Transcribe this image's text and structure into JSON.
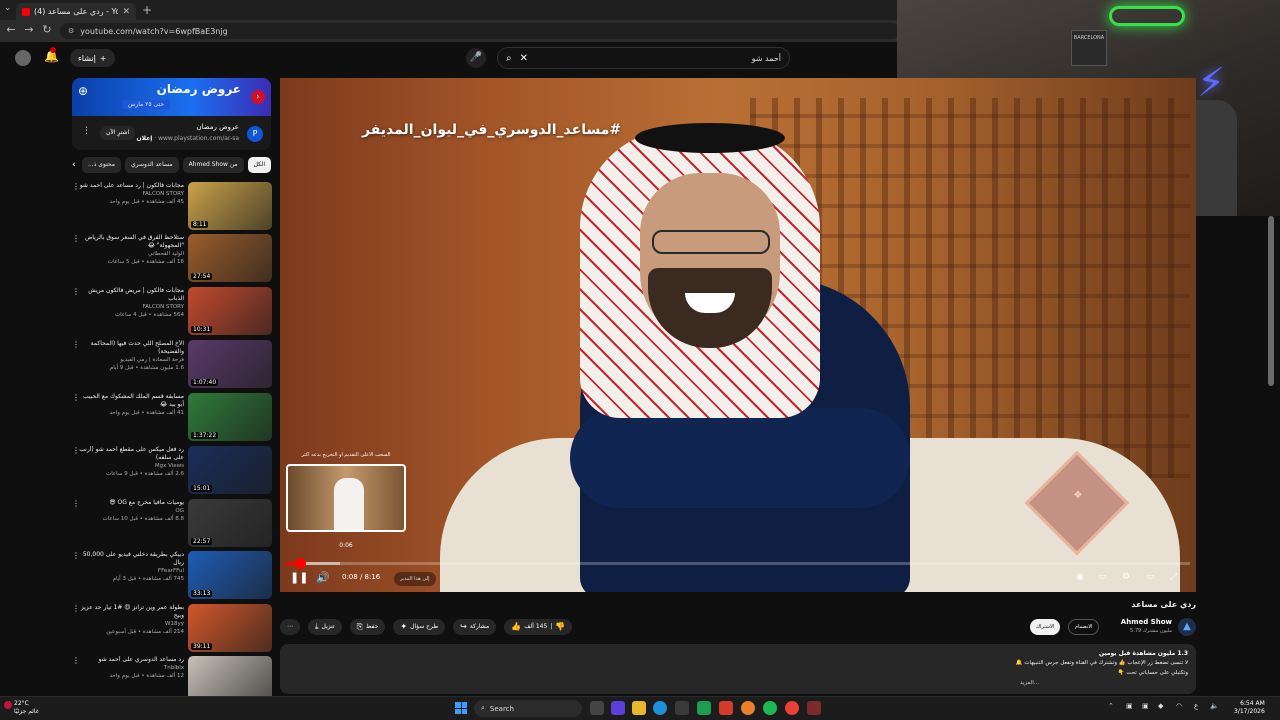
{
  "browser": {
    "tab_title": "(4) ردي على مساعد - YouTube",
    "url": "youtube.com/watch?v=6wpfBaE3njg"
  },
  "header": {
    "create_label": "إنشاء",
    "search_query": "أحمد شو"
  },
  "webcam": {
    "neon_sign": "",
    "frame_text": "BARCELONA"
  },
  "ad": {
    "banner_title": "عروض رمضان",
    "banner_sub": "حتى ٢٥ مارس",
    "title": "عروض رمضان",
    "sponsor": "إعلان",
    "domain": "www.playstation.com/ar-sa",
    "cta": "اشترِ الآن"
  },
  "chips": [
    "الكل",
    "من Ahmed Show",
    "مساعد الدوسري",
    "محتوى ذ..."
  ],
  "recommendations": [
    {
      "title": "مجابات فالكون | رد مساعد على أحمد شو",
      "channel": "FALCON STORY",
      "views": "45 ألف مشاهدة • قبل يوم واحد",
      "duration": "8:11",
      "thumb": "#c9a24a"
    },
    {
      "title": "ستلاحظ الفرق في السعر سوق بالرياض \"المجهولة\" 😂",
      "channel": "الوليد القحطاني",
      "views": "16 ألف مشاهدة • قبل 5 ساعات",
      "duration": "27:54",
      "thumb": "#9a5d2c"
    },
    {
      "title": "مجابات فالكون | مريض فالكون مريش الذباب",
      "channel": "FALCON STORY",
      "views": "564 مشاهدة • قبل 4 ساعات",
      "duration": "10:31",
      "thumb": "#c24a2f"
    },
    {
      "title": "الأخ المصلح اللي حدث فيها (المحاكمة والفضيحة)",
      "channel": "فرحة السعادة | رمي الفيديو",
      "views": "1.6 مليون مشاهدة • قبل 9 أيام",
      "duration": "1:07:40",
      "thumb": "#5a3a6a"
    },
    {
      "title": "مسابقة قسم الملك المشكوك مع الحبيب أبو بيد 😂",
      "channel": "",
      "views": "41 ألف مشاهدة • قبل يوم واحد",
      "duration": "1:37:22",
      "thumb": "#2f7a3a"
    },
    {
      "title": "رد فعل ميكس على مقطع أحمد شو (أرنب على سلفه)",
      "channel": "Mgx Views",
      "views": "2.6 ألف مشاهدة • قبل 9 ساعات",
      "duration": "15:01",
      "thumb": "#1a2e5a"
    },
    {
      "title": "يوميات مافيا مخرج مع OG 😎",
      "channel": "OG",
      "views": "8.8 ألف مشاهدة • قبل 10 ساعات",
      "duration": "22:57",
      "thumb": "#3a3a3a"
    },
    {
      "title": "دبيكي بطريقة دخلني فيديو على 50,000 ريال",
      "channel": "FFearFFul",
      "views": "745 ألف مشاهدة • قبل 3 أيام",
      "duration": "33:13",
      "thumb": "#1f5cb5"
    },
    {
      "title": "بطولة عمر وين ترانز 😍 #1 تيار حد عزيز وبيح",
      "channel": "W18yy",
      "views": "214 ألف مشاهدة • قبل أسبوعين",
      "duration": "39:11",
      "thumb": "#d0582b"
    },
    {
      "title": "رد مساعد الدوسري على أحمد شو",
      "channel": "Tnblblx",
      "views": "12 ألف مشاهدة • قبل يوم واحد",
      "duration": "",
      "thumb": "#c7c1b8"
    }
  ],
  "player": {
    "hashtag_overlay": "#مساعد_الدوسري_في_ليوان_المديفر",
    "preview_title": "السحب الأعلى التقديم أو التخريج بدعه أكثر",
    "preview_time": "0:06",
    "time_current": "0:08",
    "time_total": "8:16",
    "time_display": "0:08 / 8:16",
    "chapter_label": "إلى هذا المدير",
    "progress_fraction": 0.016,
    "hover_fraction": 0.06
  },
  "video": {
    "title": "ردي على مساعد",
    "channel": "Ahmed Show",
    "subscribers": "5.79 مليون مشترك",
    "join_label": "الانضمام",
    "subscribe_label": "الاشتراك",
    "likes": "145 ألف",
    "share_label": "مشاركة",
    "ask_label": "طرح سؤال",
    "save_label": "حفظ",
    "download_label": "تنزيل"
  },
  "description": {
    "stats": "1.3 مليون مشاهدة قبل يومين",
    "line1": "لا تنسى تضغط زر الإعجاب 👍 وتشترك في القناة وتفعل جرس التنبيهات 🔔",
    "line2": "وتكتبلي على حساباتي تحت 👇",
    "more": "...المزيد"
  },
  "taskbar": {
    "weather_temp": "22°C",
    "weather_desc": "غائم جزئيًا",
    "search_label": "Search",
    "time": "6:54 AM",
    "date": "3/17/2026"
  },
  "colors": {
    "accent": "#ff0000",
    "background": "#0f0f0f",
    "surface": "#272727"
  }
}
